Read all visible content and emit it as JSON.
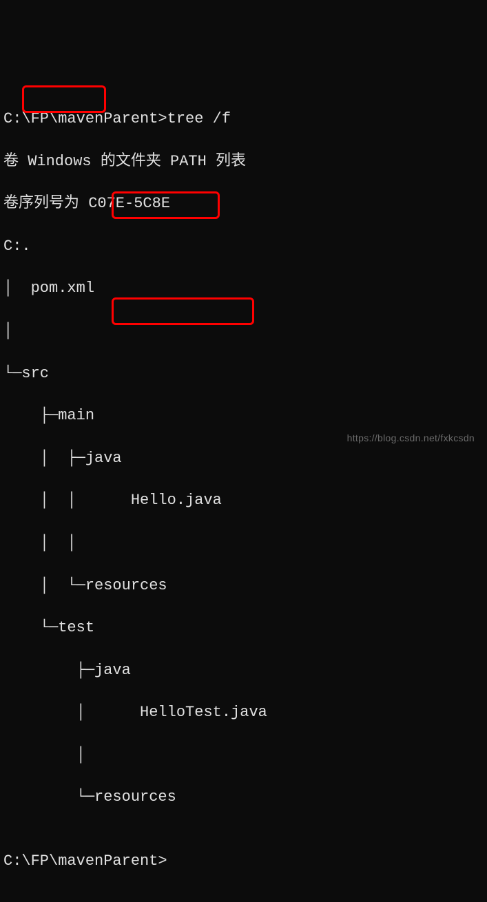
{
  "terminal": {
    "prompt1": "C:\\FP\\mavenParent>tree /f",
    "line2": "卷 Windows 的文件夹 PATH 列表",
    "line3": "卷序列号为 C07E-5C8E",
    "line4": "C:.",
    "line5": "│  pom.xml",
    "line6": "│",
    "line7": "└─src",
    "line8": "    ├─main",
    "line9": "    │  ├─java",
    "line10": "    │  │      Hello.java",
    "line11": "    │  │",
    "line12": "    │  └─resources",
    "line13": "    └─test",
    "line14": "        ├─java",
    "line15": "        │      HelloTest.java",
    "line16": "        │",
    "line17": "        └─resources",
    "line18": "",
    "prompt2": "C:\\FP\\mavenParent>"
  },
  "highlights": {
    "file1": "pom.xml",
    "file2": "Hello.java",
    "file3": "HelloTest.java"
  },
  "watermark": "https://blog.csdn.net/fxkcsdn"
}
